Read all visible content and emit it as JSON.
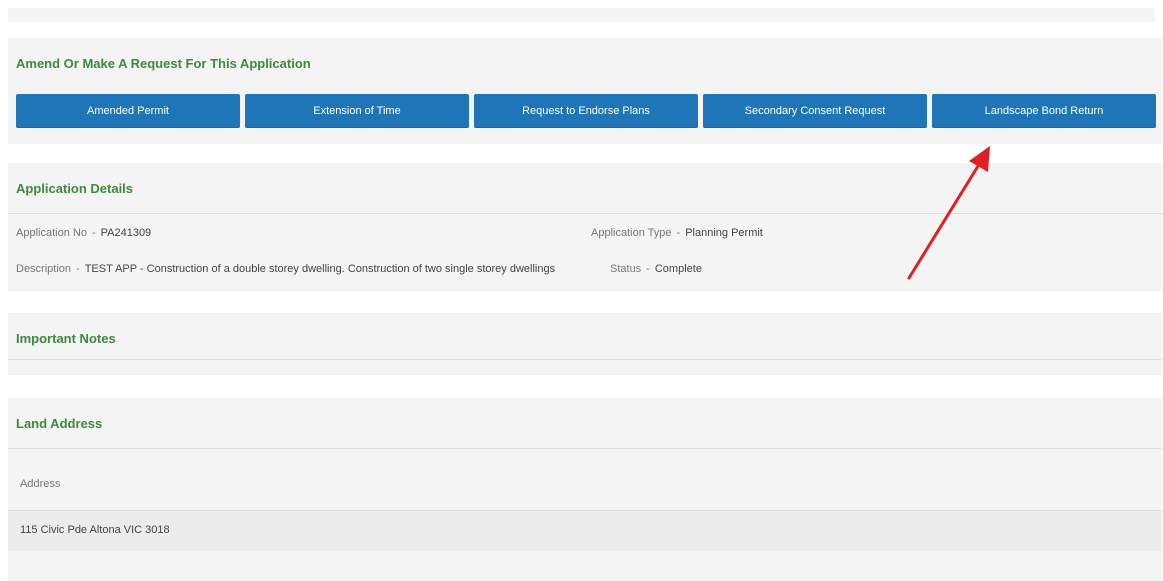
{
  "amend": {
    "title": "Amend Or Make A Request For This Application",
    "buttons": [
      {
        "label": "Amended Permit"
      },
      {
        "label": "Extension of Time"
      },
      {
        "label": "Request to Endorse Plans"
      },
      {
        "label": "Secondary Consent Request"
      },
      {
        "label": "Landscape Bond Return"
      }
    ]
  },
  "details": {
    "title": "Application Details",
    "application_no_label": "Application No",
    "application_no": "PA241309",
    "application_type_label": "Application Type",
    "application_type": "Planning Permit",
    "description_label": "Description",
    "description": "TEST APP - Construction of a double storey dwelling. Construction of two single storey dwellings",
    "status_label": "Status",
    "status": "Complete",
    "separator": "-"
  },
  "notes": {
    "title": "Important Notes"
  },
  "land_address": {
    "title": "Land Address",
    "column_header": "Address",
    "address": "115 Civic Pde Altona VIC 3018"
  },
  "colors": {
    "title_green": "#3d8a3d",
    "button_blue": "#1e76b8",
    "arrow_red": "#e02020",
    "panel_bg": "#f4f4f4"
  }
}
